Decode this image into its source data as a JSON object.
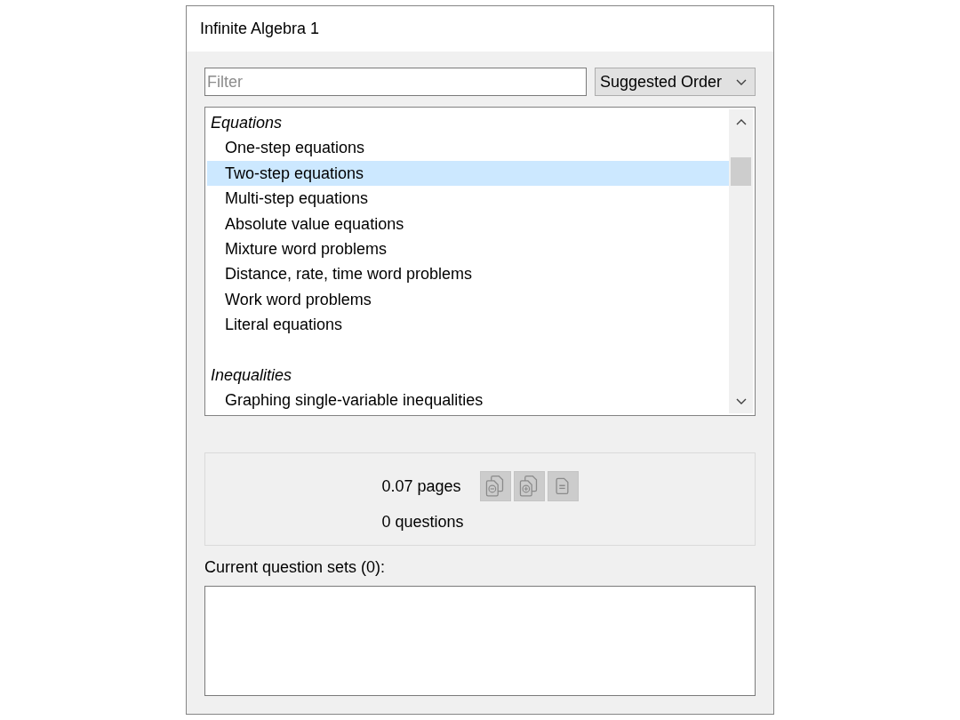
{
  "window": {
    "title": "Infinite Algebra 1"
  },
  "filter": {
    "placeholder": "Filter"
  },
  "sort_dropdown": {
    "value": "Suggested Order"
  },
  "topic_list": {
    "groups": [
      {
        "title": "Equations",
        "items": [
          {
            "label": "One-step equations",
            "selected": false
          },
          {
            "label": "Two-step equations",
            "selected": true
          },
          {
            "label": "Multi-step equations",
            "selected": false
          },
          {
            "label": "Absolute value equations",
            "selected": false
          },
          {
            "label": "Mixture word problems",
            "selected": false
          },
          {
            "label": "Distance, rate, time word problems",
            "selected": false
          },
          {
            "label": "Work word problems",
            "selected": false
          },
          {
            "label": "Literal equations",
            "selected": false
          }
        ]
      },
      {
        "title": "Inequalities",
        "items": [
          {
            "label": "Graphing single-variable inequalities",
            "selected": false
          }
        ]
      }
    ]
  },
  "summary": {
    "pages": "0.07 pages",
    "questions": "0 questions",
    "buttons": [
      {
        "kind": "remove",
        "disabled": true
      },
      {
        "kind": "add",
        "disabled": true
      },
      {
        "kind": "document",
        "disabled": true
      }
    ]
  },
  "question_sets": {
    "label": "Current question sets (0):"
  }
}
